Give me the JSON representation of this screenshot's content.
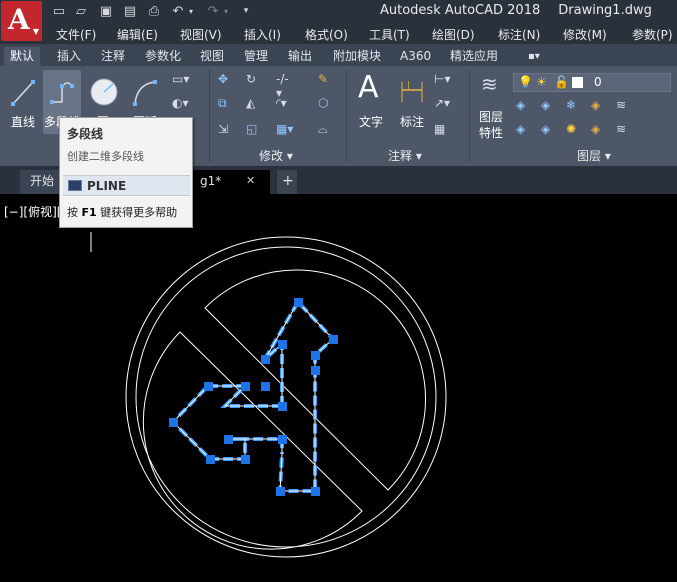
{
  "title_bar": {
    "app_letter": "A",
    "app_name": "Autodesk AutoCAD 2018",
    "document": "Drawing1.dwg",
    "quick_access": [
      "new-icon",
      "open-icon",
      "save-icon",
      "saveas-icon",
      "print-icon",
      "undo-icon",
      "redo-icon",
      "dropdown-arrow-icon"
    ]
  },
  "menu": [
    "文件(F)",
    "编辑(E)",
    "视图(V)",
    "插入(I)",
    "格式(O)",
    "工具(T)",
    "绘图(D)",
    "标注(N)",
    "修改(M)",
    "参数(P)"
  ],
  "ribbon_tabs": [
    "默认",
    "插入",
    "注释",
    "参数化",
    "视图",
    "管理",
    "输出",
    "附加模块",
    "A360",
    "精选应用"
  ],
  "ribbon_tab_extra": "▪▾",
  "ribbon": {
    "draw": {
      "line": "直线",
      "polyline": "多段线",
      "circle": "圆",
      "arc": "圆弧"
    },
    "modify": {
      "title": "修改 ▾"
    },
    "annotation": {
      "text": "文字",
      "dimension": "标注",
      "title": "注释 ▾"
    },
    "layers": {
      "properties_line1": "图层",
      "properties_line2": "特性",
      "current_layer": "0",
      "title": "图层 ▾"
    }
  },
  "file_tabs": {
    "start": "开始",
    "drawing": "g1*",
    "close": "✕",
    "add": "+"
  },
  "viewport_label": "[−][俯视][",
  "tooltip": {
    "title": "多段线",
    "description": "创建二维多段线",
    "command": "PLINE",
    "help_prefix": "按",
    "help_key": "F1",
    "help_suffix": "键获得更多帮助"
  },
  "colors": {
    "title_bar": "#2b313b",
    "ribbon": "#4d5768",
    "app_button": "#c1272d",
    "drawing_bg": "#000000",
    "grip": "#1e73e6",
    "selection": "#3d9bff"
  }
}
